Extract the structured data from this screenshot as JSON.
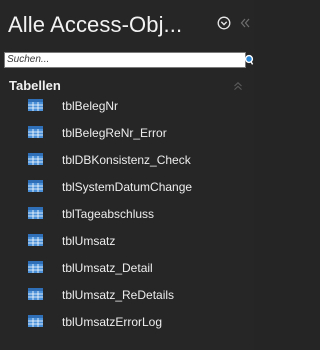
{
  "pane": {
    "title": "Alle Access-Obj...",
    "dropdown_icon": "chevron-down-circle-icon",
    "collapse_icon": "double-chevron-left-icon"
  },
  "search": {
    "placeholder": "Suchen...",
    "value": "",
    "icon": "search-icon"
  },
  "group": {
    "label": "Tabellen",
    "collapse_icon": "double-chevron-up-icon",
    "items": [
      {
        "label": "tblBelegNr",
        "icon": "table-icon"
      },
      {
        "label": "tblBelegReNr_Error",
        "icon": "table-icon"
      },
      {
        "label": "tblDBKonsistenz_Check",
        "icon": "table-icon"
      },
      {
        "label": "tblSystemDatumChange",
        "icon": "table-icon"
      },
      {
        "label": "tblTageabschluss",
        "icon": "table-icon"
      },
      {
        "label": "tblUmsatz",
        "icon": "table-icon"
      },
      {
        "label": "tblUmsatz_Detail",
        "icon": "table-icon"
      },
      {
        "label": "tblUmsatz_ReDetails",
        "icon": "table-icon"
      },
      {
        "label": "tblUmsatzErrorLog",
        "icon": "table-icon"
      }
    ]
  },
  "colors": {
    "background": "#262626",
    "text": "#f0f0f0",
    "table_icon_blue": "#4a90d9",
    "search_accent": "#2b88d8"
  }
}
